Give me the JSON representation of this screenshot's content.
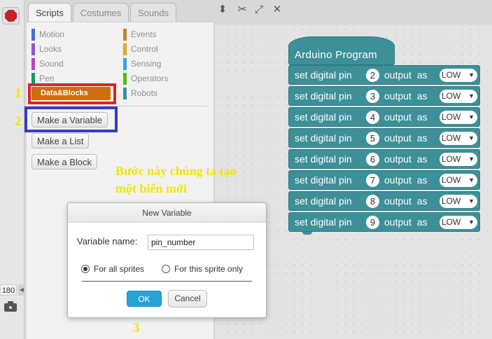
{
  "stage": {
    "zoom_label": "180"
  },
  "tabs": [
    {
      "label": "Scripts",
      "active": true
    },
    {
      "label": "Costumes",
      "active": false
    },
    {
      "label": "Sounds",
      "active": false
    }
  ],
  "toolbar_icons": [
    "stamp-icon",
    "scissors-icon",
    "grow-icon",
    "shrink-icon"
  ],
  "palette": {
    "categories_left": [
      {
        "label": "Motion",
        "color": "#4a6cd4"
      },
      {
        "label": "Looks",
        "color": "#8a55d7"
      },
      {
        "label": "Sound",
        "color": "#bb42c3"
      },
      {
        "label": "Pen",
        "color": "#0e9a6c"
      },
      {
        "label": "Data&Blocks",
        "color": "#ee7d16",
        "selected": true
      }
    ],
    "categories_right": [
      {
        "label": "Events",
        "color": "#c88330"
      },
      {
        "label": "Control",
        "color": "#e1a91a"
      },
      {
        "label": "Sensing",
        "color": "#2ca5e2"
      },
      {
        "label": "Operators",
        "color": "#5cb712"
      },
      {
        "label": "Robots",
        "color": "#3d8f98"
      }
    ],
    "buttons": [
      "Make a Variable",
      "Make a List",
      "Make a Block"
    ]
  },
  "script": {
    "hat_label": "Arduino  Program",
    "blocks": [
      {
        "prefix": "set digital pin",
        "pin": "2",
        "suffix": "output  as",
        "value": "LOW"
      },
      {
        "prefix": "set digital pin",
        "pin": "3",
        "suffix": "output  as",
        "value": "LOW"
      },
      {
        "prefix": "set digital pin",
        "pin": "4",
        "suffix": "output  as",
        "value": "LOW"
      },
      {
        "prefix": "set digital pin",
        "pin": "5",
        "suffix": "output  as",
        "value": "LOW"
      },
      {
        "prefix": "set digital pin",
        "pin": "6",
        "suffix": "output  as",
        "value": "LOW"
      },
      {
        "prefix": "set digital pin",
        "pin": "7",
        "suffix": "output  as",
        "value": "LOW"
      },
      {
        "prefix": "set digital pin",
        "pin": "8",
        "suffix": "output  as",
        "value": "LOW"
      },
      {
        "prefix": "set digital pin",
        "pin": "9",
        "suffix": "output  as",
        "value": "LOW"
      }
    ]
  },
  "caption": "Bước này chúng ta tạo\nmột biến mới",
  "annotations": {
    "n1": "1",
    "n2": "2",
    "n3": "3",
    "box_colors": {
      "red": "#e0202a",
      "blue": "#3a3ac8"
    }
  },
  "dialog": {
    "title": "New Variable",
    "var_label": "Variable name:",
    "var_value": "pin_number",
    "radio_all": "For all sprites",
    "radio_this": "For this sprite only",
    "radio_selected": "all",
    "ok_label": "OK",
    "cancel_label": "Cancel"
  }
}
